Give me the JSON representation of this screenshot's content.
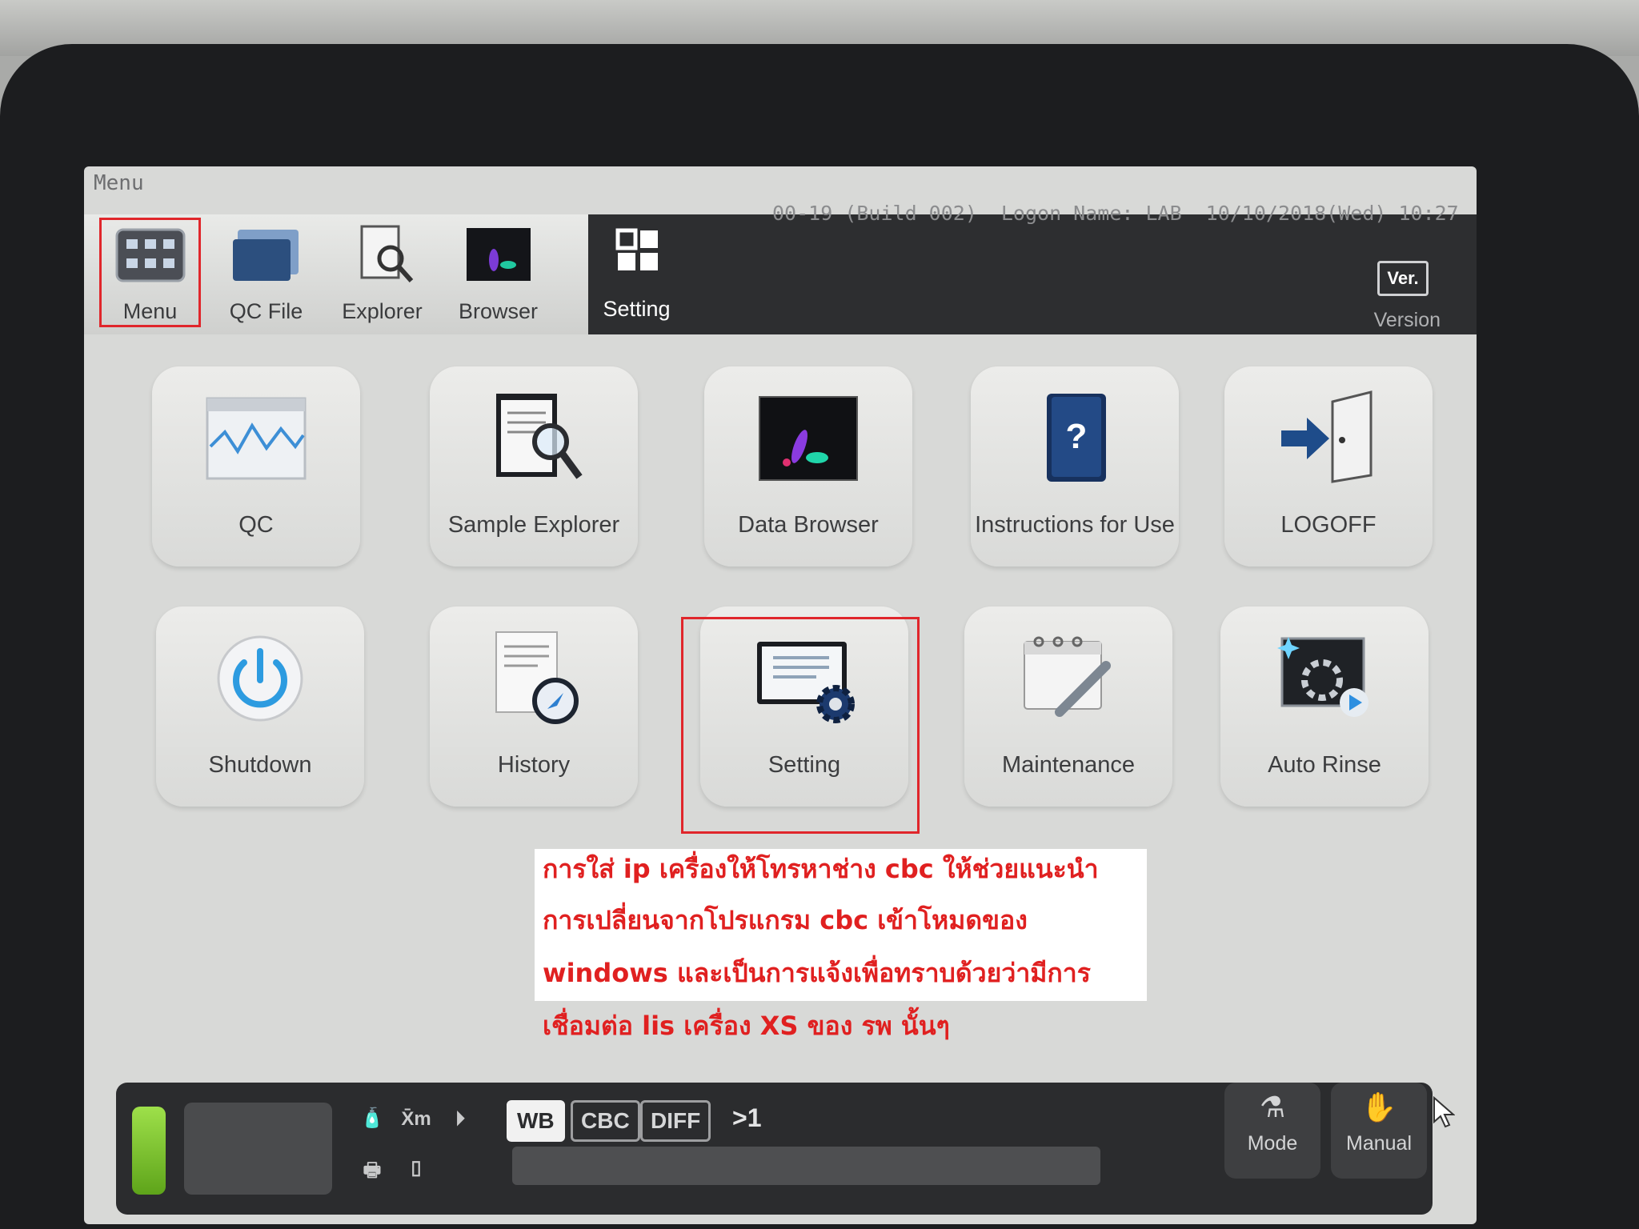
{
  "header": {
    "menu_caption": "Menu",
    "build": "00-19 (Build 002)",
    "logon": "Logon Name: LAB",
    "datetime": "10/10/2018(Wed) 10:27"
  },
  "toolbar": {
    "items": [
      {
        "label": "Menu",
        "icon": "menu-grid-icon"
      },
      {
        "label": "QC File",
        "icon": "qc-file-icon"
      },
      {
        "label": "Explorer",
        "icon": "explorer-icon"
      },
      {
        "label": "Browser",
        "icon": "browser-icon"
      },
      {
        "label": "Setting",
        "icon": "setting-grid-icon"
      }
    ],
    "version_badge": "Ver.",
    "version_label": "Version"
  },
  "tiles": [
    {
      "label": "QC",
      "icon": "qc-chart-icon"
    },
    {
      "label": "Sample Explorer",
      "icon": "sample-explorer-icon"
    },
    {
      "label": "Data Browser",
      "icon": "data-browser-icon"
    },
    {
      "label": "Instructions for Use",
      "icon": "help-book-icon"
    },
    {
      "label": "LOGOFF",
      "icon": "logoff-door-icon"
    },
    {
      "label": "Shutdown",
      "icon": "power-icon"
    },
    {
      "label": "History",
      "icon": "history-icon"
    },
    {
      "label": "Setting",
      "icon": "setting-gear-icon"
    },
    {
      "label": "Maintenance",
      "icon": "maintenance-icon"
    },
    {
      "label": "Auto Rinse",
      "icon": "auto-rinse-icon"
    }
  ],
  "note": {
    "line1": "การใส่ ip เครื่องให้โทรหาช่าง cbc ให้ช่วยแนะนำ",
    "line2": "การเปลี่ยนจากโปรแกรม cbc เข้าโหมดของ",
    "line3": "windows และเป็นการแจ้งเพื่อทราบด้วยว่ามีการ",
    "line4": "เชื่อมต่อ lis เครื่อง XS ของ รพ นั้นๆ"
  },
  "bottom": {
    "modes": [
      "WB",
      "CBC",
      "DIFF"
    ],
    "xm_label": "X̄m",
    "count": ">1",
    "buttons": [
      {
        "label": "Mode",
        "icon": "tube-mode-icon"
      },
      {
        "label": "Manual",
        "icon": "manual-icon"
      }
    ]
  },
  "colors": {
    "highlight": "#e0262b",
    "note_text": "#e02020",
    "status_led": "#7cc832"
  }
}
